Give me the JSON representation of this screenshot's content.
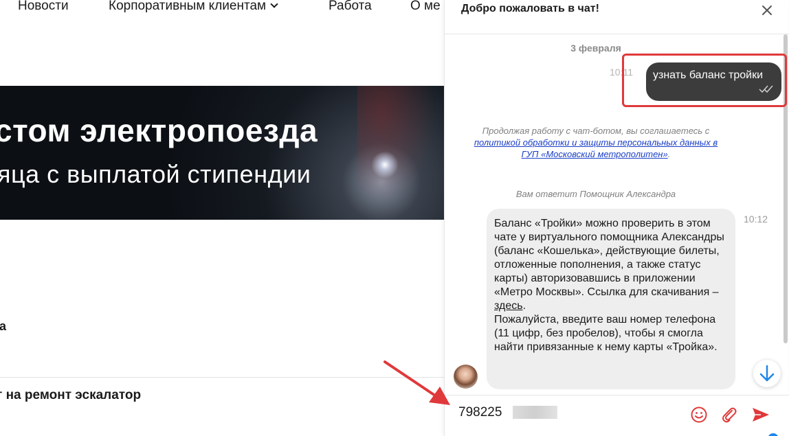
{
  "site": {
    "nav": {
      "news": "Новости",
      "corporate": "Корпоративным клиентам",
      "jobs": "Работа",
      "about": "О ме"
    },
    "banner": {
      "line1": "стом электропоезда",
      "line2": "яца с выплатой стипендии"
    },
    "stray_letter": "а",
    "news_title": "т на ремонт эскалатор"
  },
  "chat": {
    "title": "Добро пожаловать в чат!",
    "date": "3 февраля",
    "outgoing": {
      "time": "10:11",
      "text": "узнать баланс тройки"
    },
    "policy": {
      "before": "Продолжая работу с чат-ботом, вы соглашаетесь с ",
      "link": "политикой обработки и защиты персональных данных в ГУП «Московский метрополитен»",
      "after": "."
    },
    "agent_line": "Вам ответит Помощник Александра",
    "incoming": {
      "time": "10:12",
      "text_before": "Баланс «Тройки» можно проверить в этом чате у виртуального помощника Александры (баланс «Кошелька», действующие билеты, отложенные пополнения, а также статус карты) авторизовавшись в приложении «Метро Москвы». Ссылка для скачивания – ",
      "link": "здесь",
      "text_after": ".",
      "text_second": "Пожалуйста, введите ваш номер телефона (11 цифр, без пробелов), чтобы я смогла найти привязанные к нему карты «Тройка»."
    },
    "input": {
      "value": "798225"
    }
  },
  "colors": {
    "highlight": "#e0393b",
    "accent_red": "#e0393b",
    "scroll_blue": "#1e86e8",
    "outgoing_bubble": "#3c3c3c",
    "incoming_bubble": "#eeeeee"
  },
  "icons": [
    "chevron-down-icon",
    "close-icon",
    "double-check-icon",
    "arrow-down-icon",
    "emoji-icon",
    "paperclip-icon",
    "send-icon"
  ]
}
